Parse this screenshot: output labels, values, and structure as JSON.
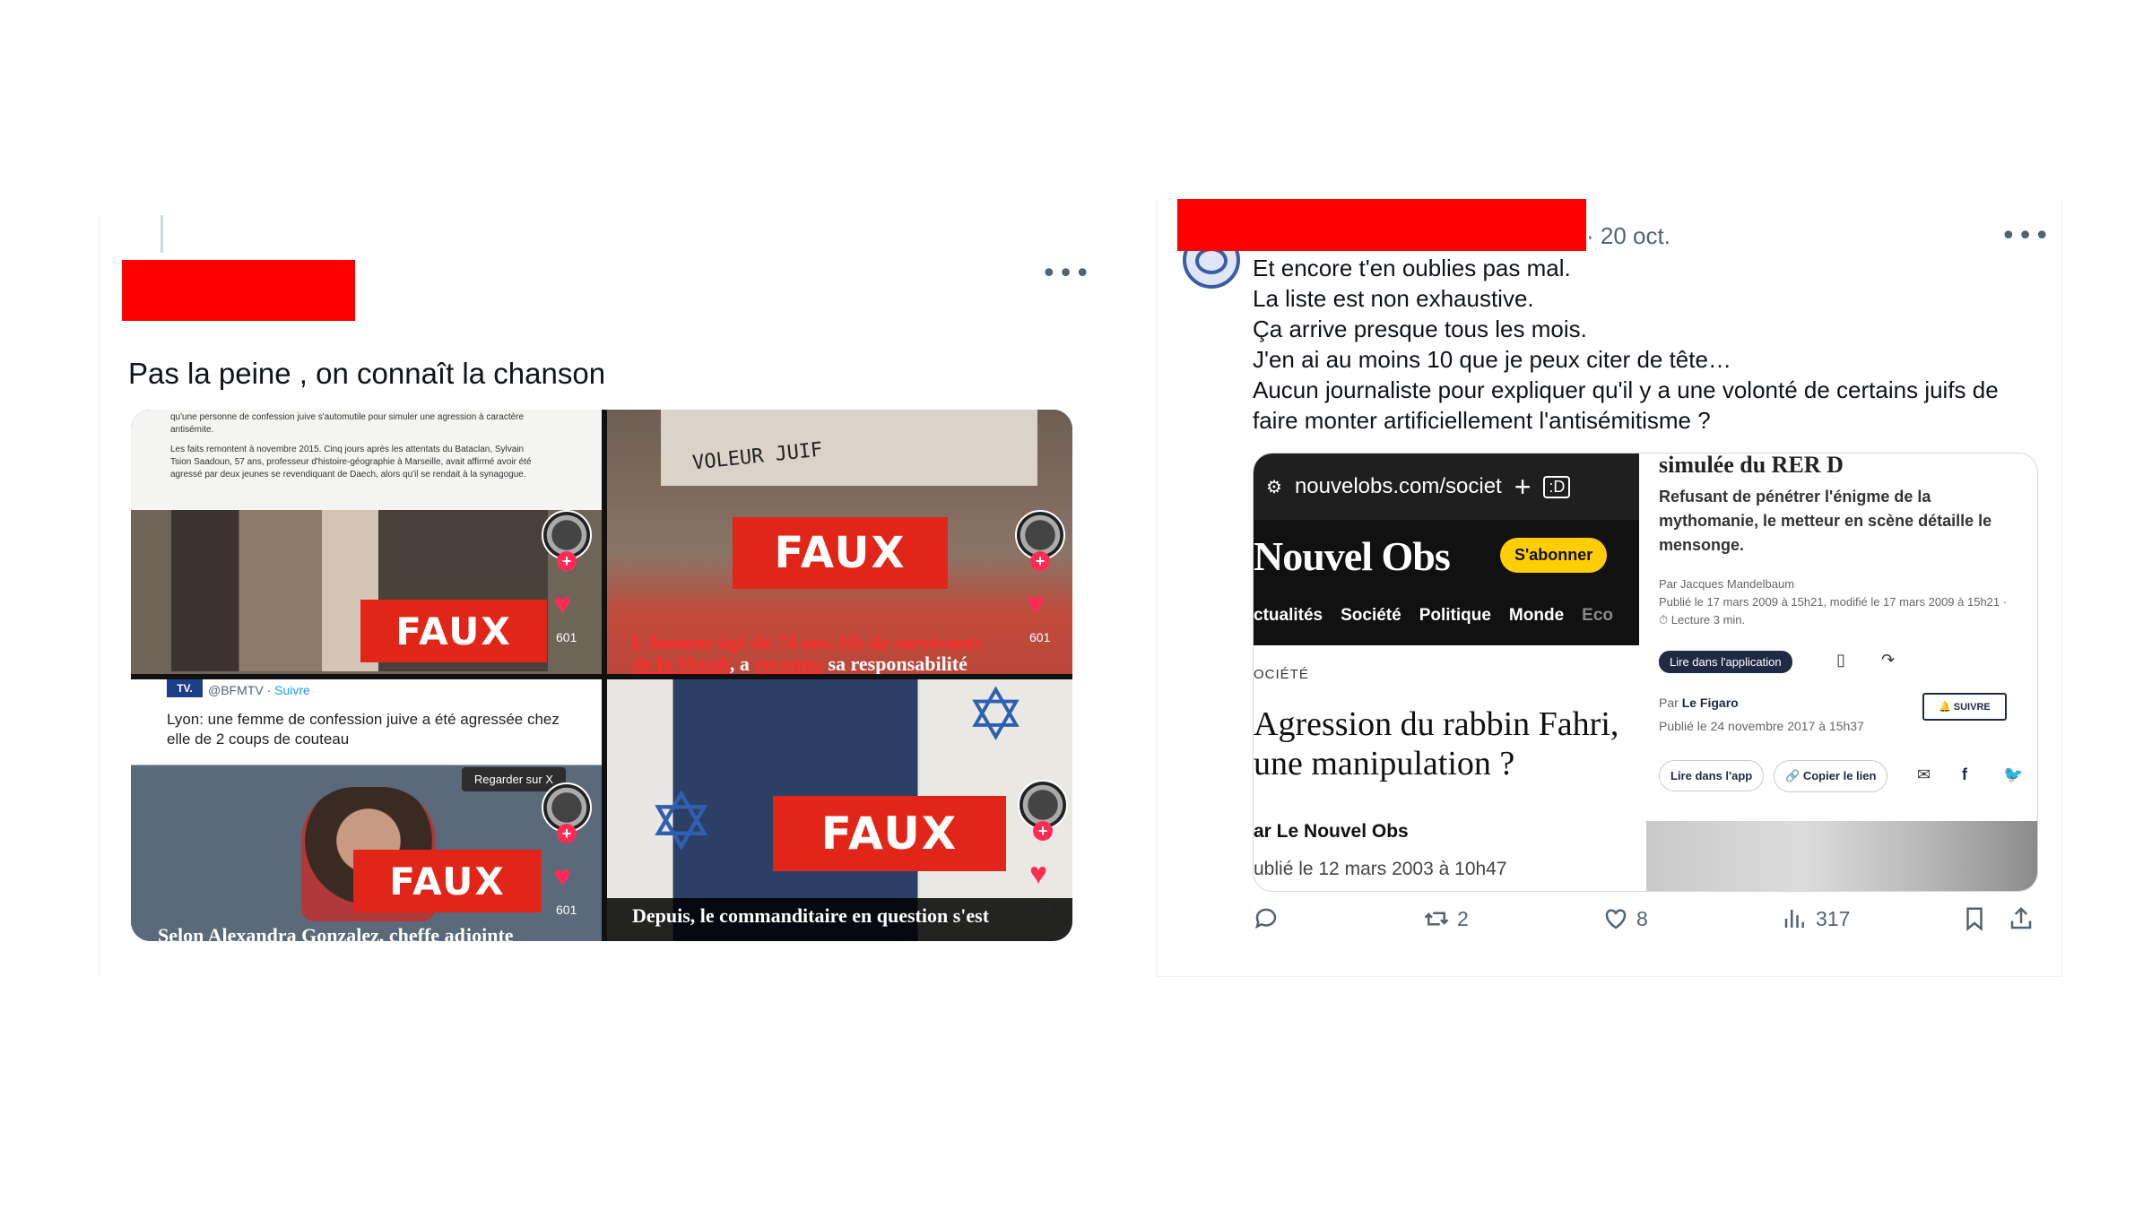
{
  "left_tweet": {
    "text": "Pas la peine , on connaît la chanson",
    "more_icon": "more-dots-icon",
    "images": {
      "cell1": {
        "doc_lines": [
          "qu'une personne de confession juive s'automutile pour simuler une agression à caractère",
          "antisémite.",
          "Les faits remontent à novembre 2015. Cinq jours après les attentats du Bataclan, Sylvain",
          "Tsion Saadoun, 57 ans, professeur d'histoire-géographie à Marseille, avait affirmé avoir été",
          "agressé par deux jeunes se revendiquant de Daech, alors qu'il se rendait à la synagogue."
        ],
        "badge": "FAUX",
        "count": "601"
      },
      "cell2": {
        "badge": "FAUX",
        "count": "601",
        "caption_line1": "L'homme âgé de 74 ans, fils de survivants",
        "caption_line2a": "de la Shoah",
        "caption_line2b": ", a ",
        "caption_line2c": "reconnu",
        "caption_line2d": " sa responsabilité"
      },
      "cell3": {
        "source": "@BFMTV · ",
        "follow": "Suivre",
        "tv_logo": "TV.",
        "headline": "Lyon: une femme de confession juive a été agressée chez elle de 2 coups de couteau",
        "watch": "Regarder sur X",
        "badge": "FAUX",
        "count": "601",
        "caption": "Selon Alexandra Gonzalez, cheffe adjointe"
      },
      "cell4": {
        "badge": "FAUX",
        "count": "601",
        "caption": "Depuis, le commanditaire en question s'est",
        "star": "✡"
      }
    },
    "colors": {
      "faux_red": "#e12619",
      "caption_red": "#ff2b2b",
      "heart": "#fe2c55"
    }
  },
  "right_tweet": {
    "date": "· 20 oct.",
    "more_icon": "more-dots-icon",
    "lines": [
      "Et encore t'en oublies pas mal.",
      "La liste est non exhaustive.",
      "Ça arrive presque tous les mois.",
      "J'en ai au moins 10 que je peux citer de tête…",
      "Aucun journaliste pour expliquer qu'il y a une volonté de certains juifs de",
      "faire monter artificiellement l'antisémitisme ?"
    ],
    "embed": {
      "url": "nouvelobs.com/societ",
      "logo": "Nouvel Obs",
      "subscribe": "S'abonner",
      "nav": [
        "ctualités",
        "Société",
        "Politique",
        "Monde",
        "Eco"
      ],
      "section": "OCIÉTÉ",
      "headline_1": "Agression du rabbin Fahri,",
      "headline_2": "une manipulation ?",
      "byline": "ar Le Nouvel Obs",
      "pubdate": "ublié le 12 mars 2003 à 10h47",
      "figaro_title": "simulée du RER D",
      "figaro_sub": "Refusant de pénétrer l'énigme de la mythomanie, le metteur en scène détaille le mensonge.",
      "figaro_author": "Par Jacques Mandelbaum",
      "figaro_dates": "Publié le 17 mars 2009 à 15h21, modifié le 17 mars 2009 à 15h21 · ",
      "figaro_read": "Lecture 3 min.",
      "read_in_app": "Lire dans l'application",
      "par_label": "Par ",
      "par_source": "Le Figaro",
      "published": "Publié le 24 novembre 2017 à 15h37",
      "follow": "SUIVRE",
      "read_app": "Lire dans l'app",
      "copy_link": "Copier le lien"
    },
    "actions": {
      "reply": "",
      "retweets": "2",
      "likes": "8",
      "views": "317"
    },
    "colors": {
      "subscribe_yellow": "#ffcd00",
      "figaro_navy": "#1f2a44"
    }
  },
  "redaction_color": "#ff0000"
}
